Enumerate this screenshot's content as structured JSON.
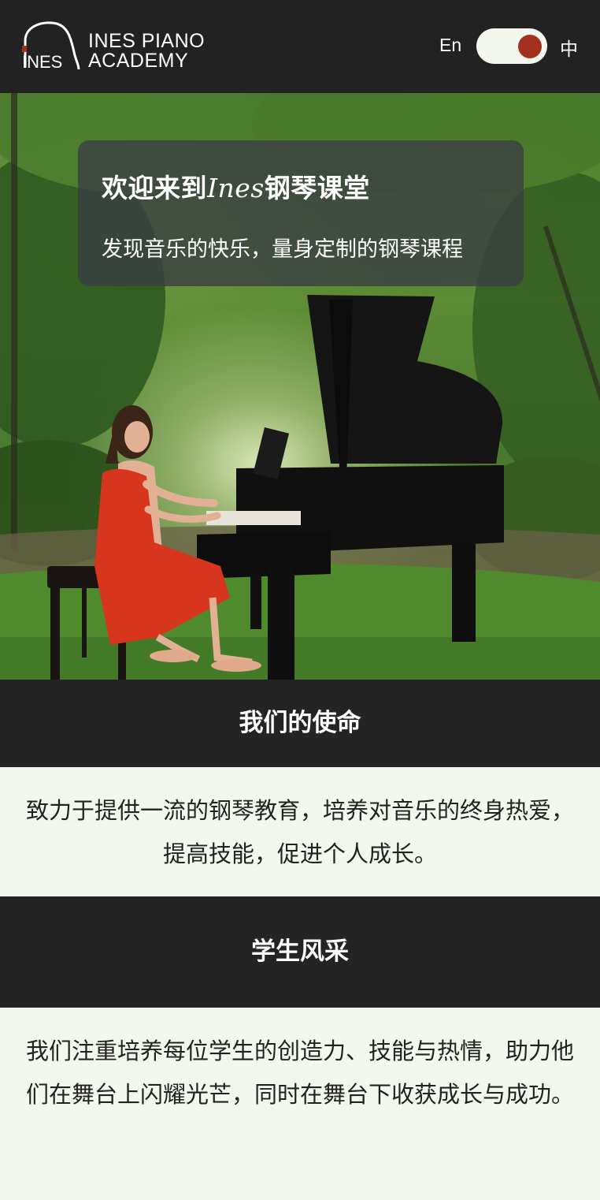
{
  "header": {
    "brand_line1": "INES PIANO",
    "brand_line2": "ACADEMY",
    "logo_mark_text": "INES",
    "lang_en_label": "En",
    "lang_zh_label": "中",
    "toggle_state": "zh",
    "colors": {
      "background": "#222222",
      "toggle_track": "#f4f7ee",
      "toggle_knob": "#a3311f"
    }
  },
  "hero": {
    "title_prefix": "欢迎来到",
    "title_brand": "Ines",
    "title_suffix": "钢琴课堂",
    "subtitle": "发现音乐的快乐，量身定制的钢琴课程",
    "image": "pianist-in-red-dress-playing-grand-piano-in-forest"
  },
  "mission": {
    "heading": "我们的使命",
    "body": "致力于提供一流的钢琴教育，培养对音乐的终身热爱，提高技能，促进个人成长。"
  },
  "students": {
    "heading": "学生风采",
    "body": "我们注重培养每位学生的创造力、技能与热情，助力他们在舞台上闪耀光芒，同时在舞台下收获成长与成功。"
  },
  "colors": {
    "section_heading_bg": "#242424",
    "section_body_bg": "#f3f8ee"
  }
}
